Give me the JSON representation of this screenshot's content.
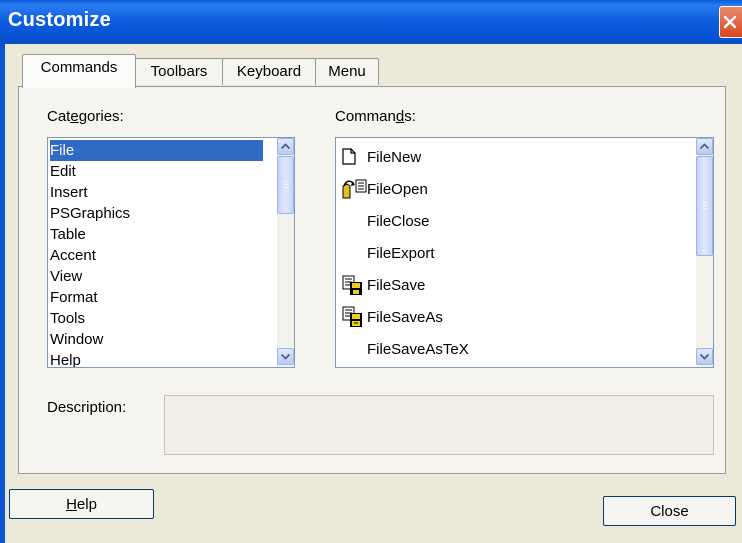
{
  "window": {
    "title": "Customize"
  },
  "tabs": [
    "Commands",
    "Toolbars",
    "Keyboard",
    "Menu"
  ],
  "categories": {
    "label_pre": "Cat",
    "label_mnemonic": "e",
    "label_post": "gories:",
    "items": [
      "File",
      "Edit",
      "Insert",
      "PSGraphics",
      "Table",
      "Accent",
      "View",
      "Format",
      "Tools",
      "Window",
      "Help"
    ],
    "selected": "File"
  },
  "commands": {
    "label_pre": "Comman",
    "label_mnemonic": "d",
    "label_post": "s:",
    "items": [
      {
        "label": "FileNew",
        "icon": "file-new-icon"
      },
      {
        "label": "FileOpen",
        "icon": "file-open-icon"
      },
      {
        "label": "FileClose",
        "icon": ""
      },
      {
        "label": "FileExport",
        "icon": ""
      },
      {
        "label": "FileSave",
        "icon": "file-save-icon"
      },
      {
        "label": "FileSaveAs",
        "icon": "file-save-as-icon"
      },
      {
        "label": "FileSaveAsTeX",
        "icon": ""
      }
    ]
  },
  "description": {
    "label": "Description:",
    "value": ""
  },
  "buttons": {
    "help_mnemonic": "H",
    "help_rest": "elp",
    "close": "Close"
  },
  "colors": {
    "titlebar": "#0a5bd8",
    "selection": "#316ac5",
    "dialog_bg": "#ece9d8"
  }
}
